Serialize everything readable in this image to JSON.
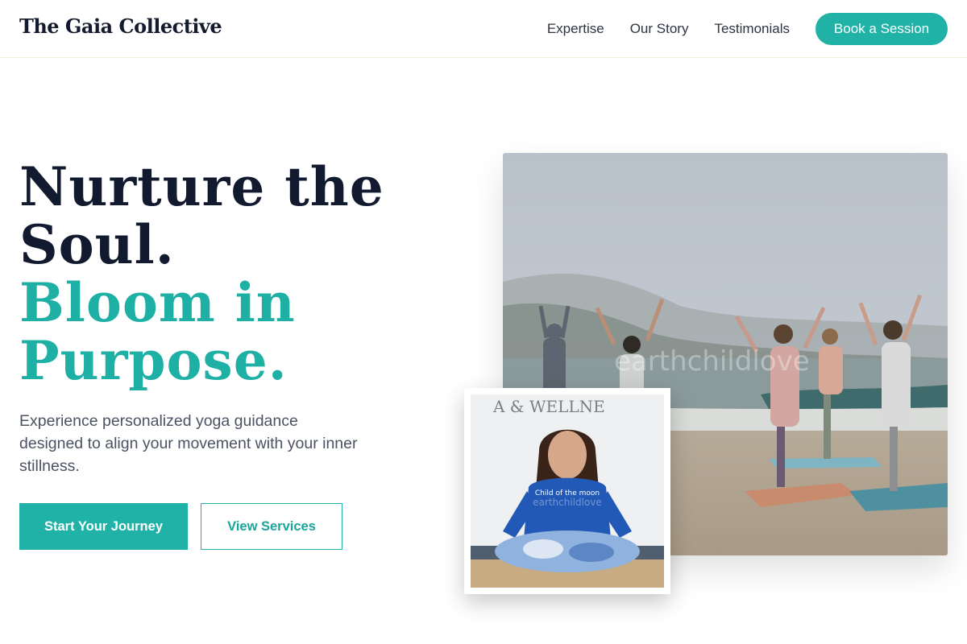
{
  "header": {
    "logo": "The Gaia Collective",
    "nav": [
      "Expertise",
      "Our Story",
      "Testimonials"
    ],
    "cta": "Book a Session"
  },
  "hero": {
    "title_line1": "Nurture the",
    "title_line2": "Soul.",
    "title_line3": "Bloom in",
    "title_line4": "Purpose.",
    "description": "Experience personalized yoga guidance designed to align your movement with your inner stillness.",
    "primary_button": "Start Your Journey",
    "secondary_button": "View Services"
  },
  "images": {
    "main_watermark": "earthchildlove",
    "inset_sweatshirt_text": "Child of the moon",
    "inset_wall_text": "A & WELLNE",
    "inset_watermark": "earthchildlove"
  },
  "colors": {
    "accent": "#20b2a7",
    "heading_dark": "#121a30",
    "body_text": "#4b5262"
  }
}
